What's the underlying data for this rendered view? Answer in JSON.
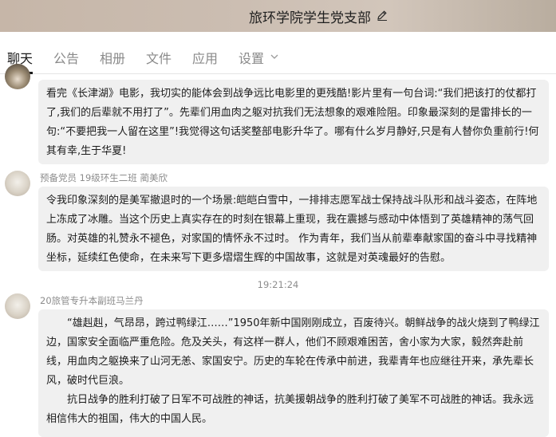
{
  "window": {
    "title": "旅环学院学生党支部"
  },
  "tabs": [
    {
      "label": "聊天"
    },
    {
      "label": "公告"
    },
    {
      "label": "相册"
    },
    {
      "label": "文件"
    },
    {
      "label": "应用"
    },
    {
      "label": "设置"
    }
  ],
  "messages": [
    {
      "sender": "",
      "text": "看完《长津湖》电影，我切实的能体会到战争远比电影里的更残酷!影片里有一句台词:“我们把该打的仗都打了,我们的后辈就不用打了”。先辈们用血肉之躯对抗我们无法想象的艰难险阻。印象最深刻的是雷排长的一句:“不要把我一人留在这里”!我觉得这句话奖整部电影升华了。哪有什么岁月静好,只是有人替你负重前行!何其有幸,生于华夏!"
    },
    {
      "sender": "预备党员 19级环生二班 蔺美欣",
      "text": "令我印象深刻的是美军撤退时的一个场景:皑皑白雪中，一排排志愿军战士保持战斗队形和战斗姿态，在阵地上冻成了冰雕。当这个历史上真实存在的时刻在银幕上重现，我在震撼与感动中体悟到了英雄精神的荡气回肠。对英雄的礼赞永不褪色，对家国的情怀永不过时。 作为青年，我们当从前辈奉献家国的奋斗中寻找精神坐标，延续红色使命，在未来写下更多熠熠生辉的中国故事，这就是对英魂最好的告慰。"
    },
    {
      "timestamp": "19:21:24",
      "sender": "20旅管专升本副班马兰丹",
      "paragraphs": [
        "“雄赳赳，气昂昂，跨过鸭绿江……”1950年新中国刚刚成立，百废待兴。朝鲜战争的战火烧到了鸭绿江边，国家安全面临严重危险。危及关头，有这样一群人，他们不顾艰难困苦，舍小家为大家，毅然奔赴前线，用血肉之躯换来了山河无恙、家国安宁。历史的车轮在传承中前进，我辈青年也应继往开来，承先辈长风，破时代巨浪。",
        "抗日战争的胜利打破了日军不可战胜的神话，抗美援朝战争的胜利打破了美军不可战胜的神话。我永远相信伟大的祖国，伟大的中国人民。"
      ]
    }
  ],
  "icons": {
    "edit": "pencil-icon",
    "settings_dropdown": "chevron-down-icon"
  },
  "colors": {
    "bubble_bg": "#f0f0f0",
    "active_tab": "#1a1a1a",
    "inactive_tab": "#8a8a8a"
  }
}
